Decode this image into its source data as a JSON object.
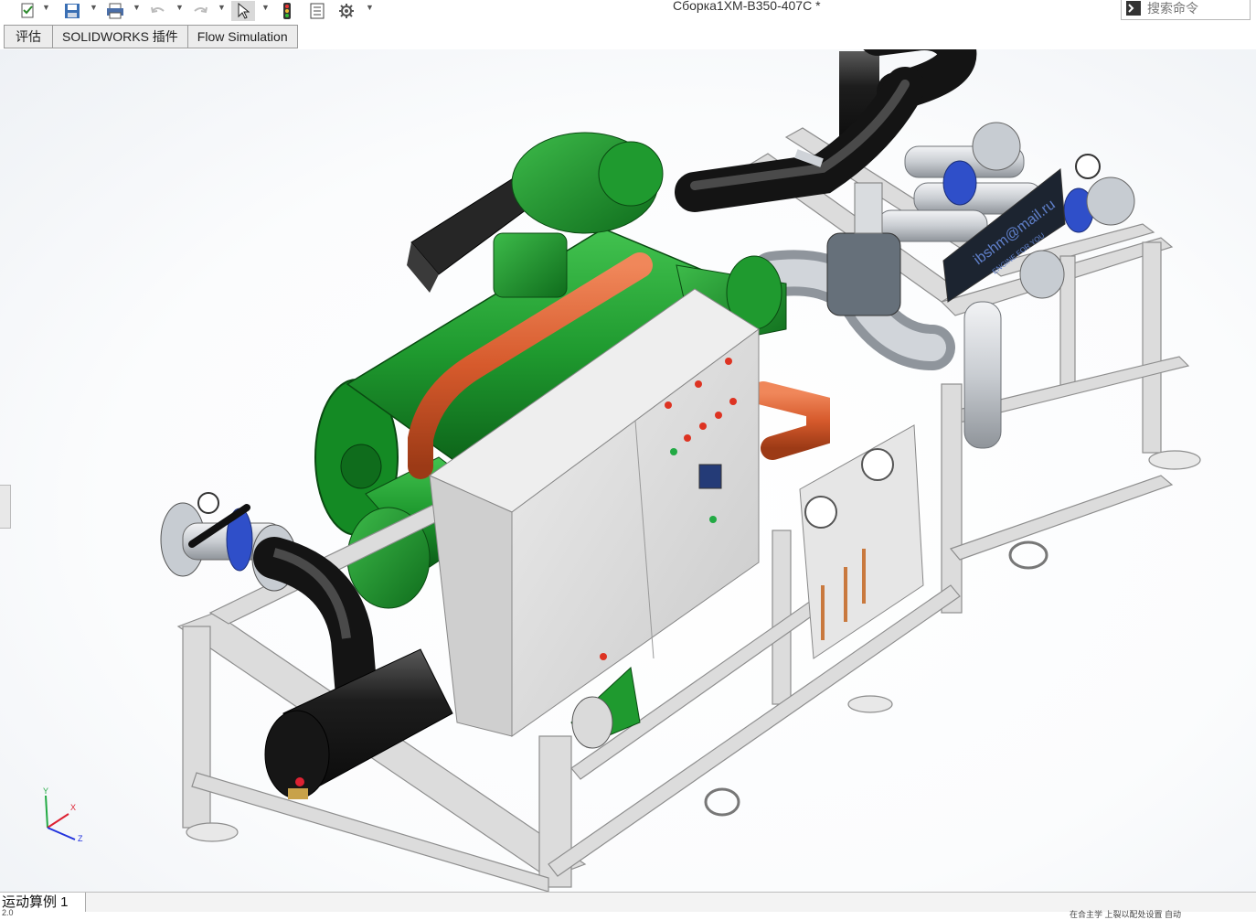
{
  "window": {
    "title": "Сборка1ХМ-В350-407С *"
  },
  "search": {
    "placeholder": "搜索命令"
  },
  "tabs": [
    {
      "label": "评估"
    },
    {
      "label": "SOLIDWORKS 插件"
    },
    {
      "label": "Flow Simulation"
    }
  ],
  "model": {
    "sign_text": "ibshm@mail.ru",
    "sign_subtext": "ENGINE FOR YOU"
  },
  "triad": {
    "x": "X",
    "y": "Y",
    "z": "Z"
  },
  "status": {
    "tab": "运动算例 1",
    "left": "2.0",
    "right": "在合主学 上裂以配处设置 自动"
  },
  "colors": {
    "green": "#1f9a2f",
    "orange": "#d65a2c",
    "frame": "#dcdcdc",
    "pipe_black": "#1d1d1d",
    "steel": "#c9cdd2",
    "blue_valve": "#2f4fc9",
    "cabinet": "#dadada"
  }
}
